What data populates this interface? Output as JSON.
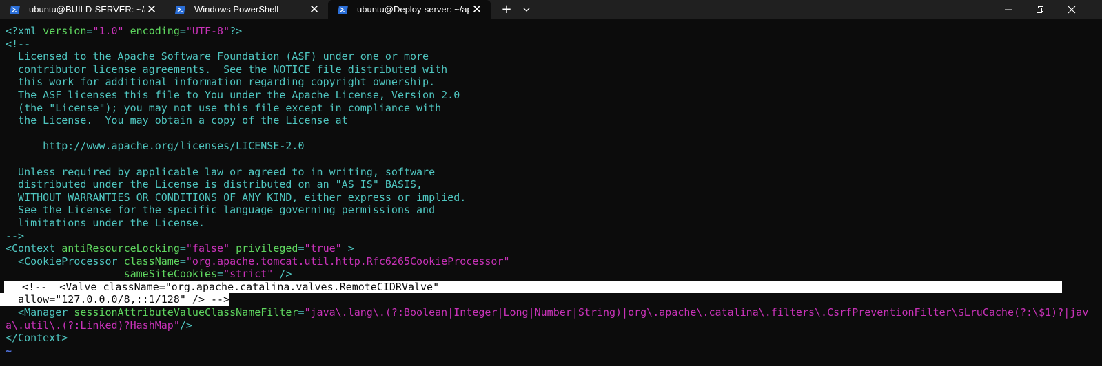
{
  "tabs": [
    {
      "label": "ubuntu@BUILD-SERVER: ~/Jav",
      "icon": "powershell-icon",
      "active": false
    },
    {
      "label": "Windows PowerShell",
      "icon": "powershell-icon",
      "active": false
    },
    {
      "label": "ubuntu@Deploy-server: ~/ap",
      "icon": "powershell-icon",
      "active": true
    }
  ],
  "titlebar": {
    "new_tab": "+",
    "dropdown": "⌄",
    "minimize": "—",
    "maximize": "❐",
    "close": "✕"
  },
  "colors": {
    "background": "#0c0c0c",
    "comment": "#4fc6c0",
    "attribute": "#5fd75f",
    "value": "#c832b8",
    "plain": "#d8d8d8"
  },
  "terminal": {
    "l1": {
      "a": "<?xml ",
      "b": "version",
      "c": "=",
      "d": "\"1.0\"",
      "e": " ",
      "f": "encoding",
      "g": "=",
      "h": "\"UTF-8\"",
      "i": "?>"
    },
    "l2": "<!--",
    "l3": "  Licensed to the Apache Software Foundation (ASF) under one or more",
    "l4": "  contributor license agreements.  See the NOTICE file distributed with",
    "l5": "  this work for additional information regarding copyright ownership.",
    "l6": "  The ASF licenses this file to You under the Apache License, Version 2.0",
    "l7": "  (the \"License\"); you may not use this file except in compliance with",
    "l8": "  the License.  You may obtain a copy of the License at",
    "l9": "",
    "l10": "      http://www.apache.org/licenses/LICENSE-2.0",
    "l11": "",
    "l12": "  Unless required by applicable law or agreed to in writing, software",
    "l13": "  distributed under the License is distributed on an \"AS IS\" BASIS,",
    "l14": "  WITHOUT WARRANTIES OR CONDITIONS OF ANY KIND, either express or implied.",
    "l15": "  See the License for the specific language governing permissions and",
    "l16": "  limitations under the License.",
    "l17": "-->",
    "l18": {
      "a": "<Context ",
      "b": "antiResourceLocking",
      "c": "=",
      "d": "\"false\"",
      "e": " ",
      "f": "privileged",
      "g": "=",
      "h": "\"true\"",
      "i": " >"
    },
    "l19": {
      "a": "  <CookieProcessor ",
      "b": "className",
      "c": "=",
      "d": "\"org.apache.tomcat.util.http.Rfc6265CookieProcessor\""
    },
    "l20": {
      "a": "                   ",
      "b": "sameSiteCookies",
      "c": "=",
      "d": "\"strict\"",
      "e": " />"
    },
    "l21": "  <!--  <Valve className=\"org.apache.catalina.valves.RemoteCIDRValve\"",
    "l22": "  allow=\"127.0.0.0/8,::1/128\" /> -->",
    "l23": {
      "a": "  <Manager ",
      "b": "sessionAttributeValueClassNameFilter",
      "c": "=",
      "d": "\"java\\.lang\\.(?:Boolean|Integer|Long|Number|String)|org\\.apache\\.catalina\\.filters\\.CsrfPreventionFilter\\$LruCache(?:\\$1)?|jav"
    },
    "l24": {
      "a": "a\\.util\\.(?:Linked)?HashMap\"",
      "b": "/>"
    },
    "l25": "</Context>",
    "l26": "~"
  }
}
